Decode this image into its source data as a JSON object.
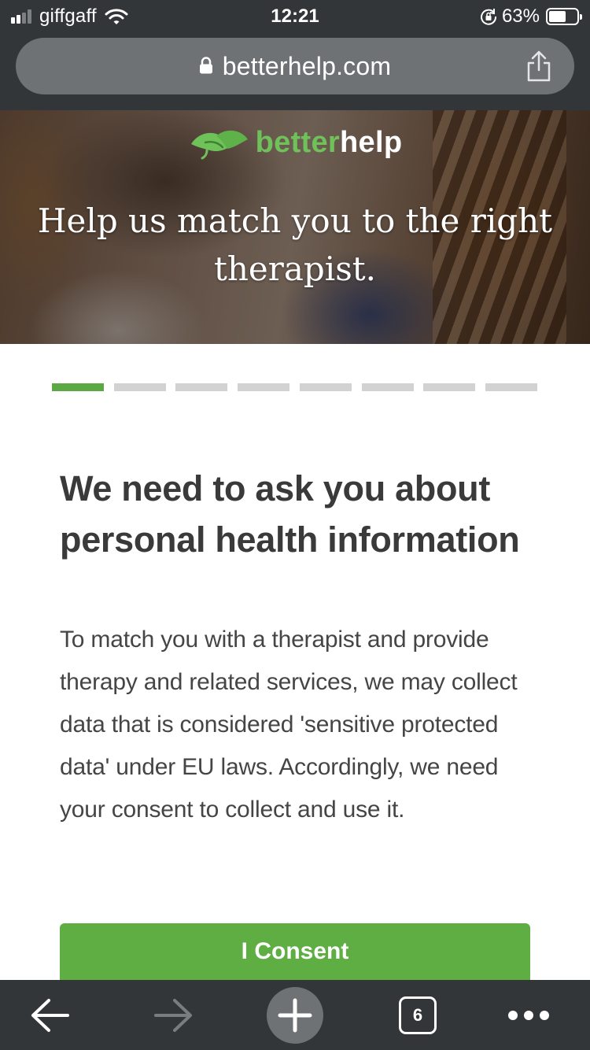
{
  "status_bar": {
    "carrier": "giffgaff",
    "time": "12:21",
    "battery_percent": "63%",
    "battery_level": 0.63
  },
  "browser": {
    "url": "betterhelp.com",
    "tab_count": "6"
  },
  "hero": {
    "brand_part1": "better",
    "brand_part2": "help",
    "title": "Help us match you to the right therapist."
  },
  "progress": {
    "total_steps": 8,
    "current_step": 1
  },
  "content": {
    "heading": "We need to ask you about personal health information",
    "body": "To match you with a therapist and provide therapy and related services, we may collect data that is considered 'sensitive protected data' under EU laws. Accordingly, we need your consent to collect and use it.",
    "consent_label": "I Consent"
  },
  "colors": {
    "brand_green": "#6fc25a",
    "button_green": "#5fae43",
    "chrome_dark": "#333638"
  },
  "icons": {
    "signal": "cellular-signal-icon",
    "wifi": "wifi-icon",
    "rotation_lock": "rotation-lock-icon",
    "battery": "battery-icon",
    "lock": "lock-icon",
    "share": "share-icon",
    "logo": "leaf-logo-icon",
    "back": "back-arrow-icon",
    "forward": "forward-arrow-icon",
    "new_tab": "plus-icon",
    "tabs": "tabs-icon",
    "menu": "more-dots-icon"
  }
}
